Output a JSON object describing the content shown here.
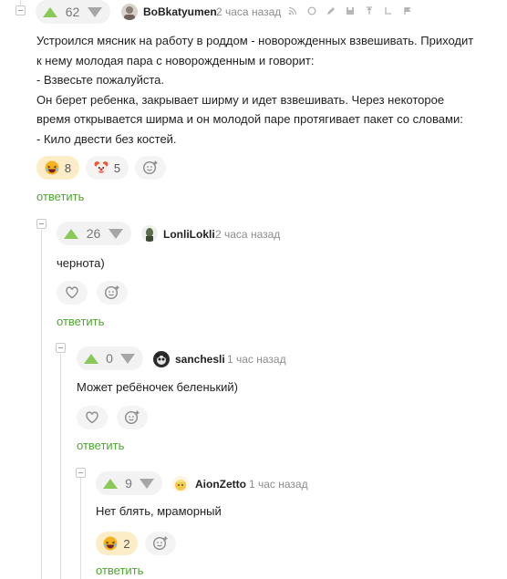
{
  "colors": {
    "accent_green": "#4ea72e",
    "upvote_green": "#8ac858",
    "downvote_gray": "#a6a6a6",
    "active_reaction_bg": "#fdedc6"
  },
  "comments": [
    {
      "rating": "62",
      "author": "BoBkatyumen",
      "time": "2 часа назад",
      "text_lines": [
        "Устроился мясник на работу в роддом - новорожденных взвешивать. Приходит",
        "к нему молодая пара с новорожденным и говорит:",
        "- Взвесьте пожалуйста.",
        "Он берет ребенка, закрывает ширму и идет взвешивать. Через некоторое",
        "время открывается ширма и он молодой паре протягивает пакет со словами:",
        "- Кило двести без костей."
      ],
      "reactions": [
        {
          "icon": "laughing-face-icon",
          "count": "8"
        },
        {
          "icon": "clown-face-icon",
          "count": "5"
        }
      ],
      "reply_label": "ответить",
      "header_tools": [
        "share-icon",
        "link-icon",
        "edit-icon",
        "save-icon",
        "pin-icon",
        "hide-icon",
        "flag-icon"
      ]
    },
    {
      "rating": "26",
      "author": "LonliLokli",
      "time": "2 часа назад",
      "text": "чернота)",
      "reactions": [],
      "reply_label": "ответить"
    },
    {
      "rating": "0",
      "author": "sanchesli",
      "time": "1 час назад",
      "text": "Может ребёночек беленький)",
      "reactions": [],
      "reply_label": "ответить"
    },
    {
      "rating": "9",
      "author": "AionZetto",
      "time": "1 час назад",
      "text": "Нет блять, мраморный",
      "reactions": [
        {
          "icon": "laughing-face-icon",
          "count": "2"
        }
      ],
      "reply_label": "ответить"
    }
  ]
}
